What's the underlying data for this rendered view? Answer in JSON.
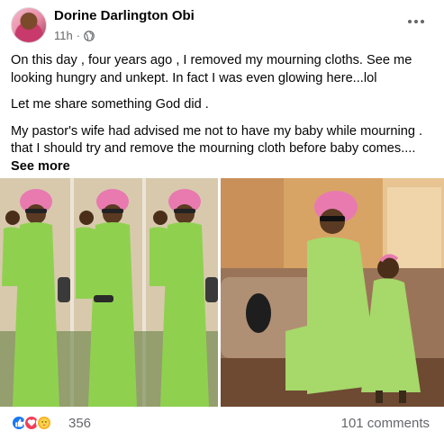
{
  "post": {
    "author": "Dorine Darlington Obi",
    "time": "11h",
    "separator": "·",
    "paragraphs": [
      "On this day , four years ago , I removed my mourning cloths. See me looking hungry and unkept. In fact I was even glowing here...lol",
      "Let me share something God did .",
      "My pastor's wife had advised me not to have my baby while mourning . that I should try and remove the mourning cloth before baby comes...."
    ],
    "see_more": "See more"
  },
  "reactions": {
    "icons": [
      "like-icon",
      "love-icon",
      "care-icon"
    ],
    "count": "356",
    "comments": "101 comments"
  },
  "colors": {
    "text": "#050505",
    "secondary": "#65676b",
    "like": "#1877f2",
    "love": "#f33e58",
    "care": "#f7b125",
    "outfit_green": "#8fd14f",
    "gele_pink": "#e87ab0"
  }
}
